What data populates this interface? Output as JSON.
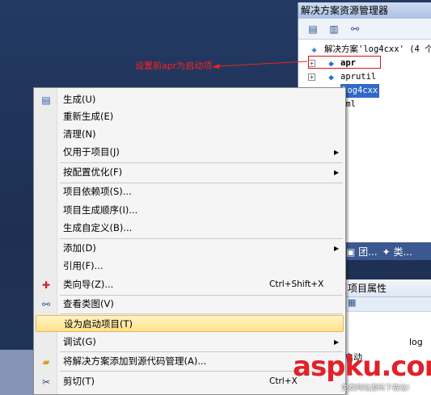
{
  "solution_explorer": {
    "title": "解决方案资源管理器",
    "root_label": "解决方案'log4cxx' (4 个",
    "projects": [
      "apr",
      "aprutil",
      "log4cxx",
      "xml"
    ],
    "bottom_tabs": [
      "团...",
      "类..."
    ]
  },
  "properties": {
    "title": "项目属性",
    "row1_value": "log",
    "row2_label": "启动"
  },
  "annotation": {
    "text": "设置前apr为启动项"
  },
  "context_menu": {
    "items": [
      {
        "label": "生成(U)",
        "icon": "build-icon",
        "shortcut": "",
        "submenu": false
      },
      {
        "label": "重新生成(E)",
        "icon": "",
        "shortcut": "",
        "submenu": false
      },
      {
        "label": "清理(N)",
        "icon": "",
        "shortcut": "",
        "submenu": false
      },
      {
        "label": "仅用于项目(J)",
        "icon": "",
        "shortcut": "",
        "submenu": true
      },
      {
        "label": "按配置优化(F)",
        "icon": "",
        "shortcut": "",
        "submenu": true
      },
      {
        "label": "项目依赖项(S)...",
        "icon": "",
        "shortcut": "",
        "submenu": false
      },
      {
        "label": "项目生成顺序(I)...",
        "icon": "",
        "shortcut": "",
        "submenu": false
      },
      {
        "label": "生成自定义(B)...",
        "icon": "",
        "shortcut": "",
        "submenu": false
      },
      {
        "label": "添加(D)",
        "icon": "",
        "shortcut": "",
        "submenu": true
      },
      {
        "label": "引用(F)...",
        "icon": "",
        "shortcut": "",
        "submenu": false
      },
      {
        "label": "类向导(Z)...",
        "icon": "class-wizard-icon",
        "shortcut": "Ctrl+Shift+X",
        "submenu": false
      },
      {
        "label": "查看类图(V)",
        "icon": "class-diagram-icon",
        "shortcut": "",
        "submenu": false
      },
      {
        "label": "设为启动项目(T)",
        "icon": "",
        "shortcut": "",
        "submenu": false
      },
      {
        "label": "调试(G)",
        "icon": "",
        "shortcut": "",
        "submenu": true
      },
      {
        "label": "将解决方案添加到源代码管理(A)...",
        "icon": "source-control-icon",
        "shortcut": "",
        "submenu": false
      },
      {
        "label": "剪切(T)",
        "icon": "scissors-icon",
        "shortcut": "Ctrl+X",
        "submenu": false
      }
    ]
  },
  "watermark": {
    "brand": "aspku.com",
    "sub": "免费网站源码下载站!"
  }
}
